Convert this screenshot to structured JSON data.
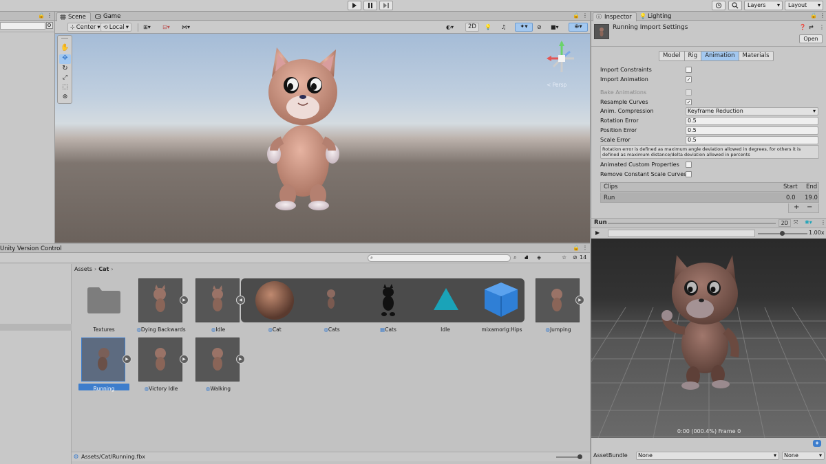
{
  "toolbar": {
    "layers_label": "Layers",
    "layout_label": "Layout",
    "play_icon": "play-icon",
    "pause_icon": "pause-icon",
    "step_icon": "step-icon"
  },
  "hierarchy": {
    "version_control_label": "Unity Version Control"
  },
  "scene": {
    "tabs": [
      {
        "label": "Scene"
      },
      {
        "label": "Game"
      }
    ],
    "pivot_label": "Center",
    "space_label": "Local",
    "mode_2d": "2D",
    "gizmo_label": "< Persp"
  },
  "project": {
    "breadcrumb": [
      "Assets",
      "Cat"
    ],
    "search_value": "",
    "hidden_count": "14",
    "assets": [
      {
        "label": "Textures",
        "type": "folder"
      },
      {
        "label": "Dying Backwards",
        "type": "model"
      },
      {
        "label": "Idle",
        "type": "model"
      },
      {
        "label": "Cat",
        "type": "material"
      },
      {
        "label": "Cats",
        "type": "mesh"
      },
      {
        "label": "Cats",
        "type": "avatar"
      },
      {
        "label": "Idle",
        "type": "clip"
      },
      {
        "label": "mixamorig:Hips",
        "type": "prefab"
      },
      {
        "label": "Jumping",
        "type": "model"
      },
      {
        "label": "Running",
        "type": "model",
        "selected": true
      },
      {
        "label": "Victory Idle",
        "type": "model"
      },
      {
        "label": "Walking",
        "type": "model"
      }
    ],
    "status_path": "Assets/Cat/Running.fbx"
  },
  "inspector": {
    "tabs": [
      {
        "label": "Inspector"
      },
      {
        "label": "Lighting"
      }
    ],
    "title": "Running Import Settings",
    "open_label": "Open",
    "subtabs": [
      "Model",
      "Rig",
      "Animation",
      "Materials"
    ],
    "active_subtab": "Animation",
    "rows": {
      "import_constraints": {
        "label": "Import Constraints",
        "checked": false
      },
      "import_animation": {
        "label": "Import Animation",
        "checked": true
      },
      "bake_animations": {
        "label": "Bake Animations",
        "checked": false
      },
      "resample_curves": {
        "label": "Resample Curves",
        "checked": true
      },
      "anim_compression": {
        "label": "Anim. Compression",
        "value": "Keyframe Reduction"
      },
      "rotation_error": {
        "label": "Rotation Error",
        "value": "0.5"
      },
      "position_error": {
        "label": "Position Error",
        "value": "0.5"
      },
      "scale_error": {
        "label": "Scale Error",
        "value": "0.5"
      },
      "animated_custom": {
        "label": "Animated Custom Properties",
        "checked": false
      },
      "remove_scale": {
        "label": "Remove Constant Scale Curves",
        "checked": false
      }
    },
    "help_text": "Rotation error is defined as maximum angle deviation allowed in degrees, for others it is defined as maximum distance/delta deviation allowed in percents",
    "clips": {
      "header": "Clips",
      "start_label": "Start",
      "end_label": "End",
      "rows": [
        {
          "name": "Run",
          "start": "0.0",
          "end": "19.0"
        }
      ]
    },
    "plus_label": "+",
    "minus_label": "−"
  },
  "preview": {
    "clip_name": "Run",
    "mode_2d": "2D",
    "speed": "1.00x",
    "frame_info": "0:00 (000.4%) Frame 0",
    "assetbundle_label": "AssetBundle",
    "assetbundle_value": "None",
    "variant_value": "None"
  },
  "colors": {
    "accent": "#3d7dcc",
    "selected_tab": "#a3c8f0"
  }
}
